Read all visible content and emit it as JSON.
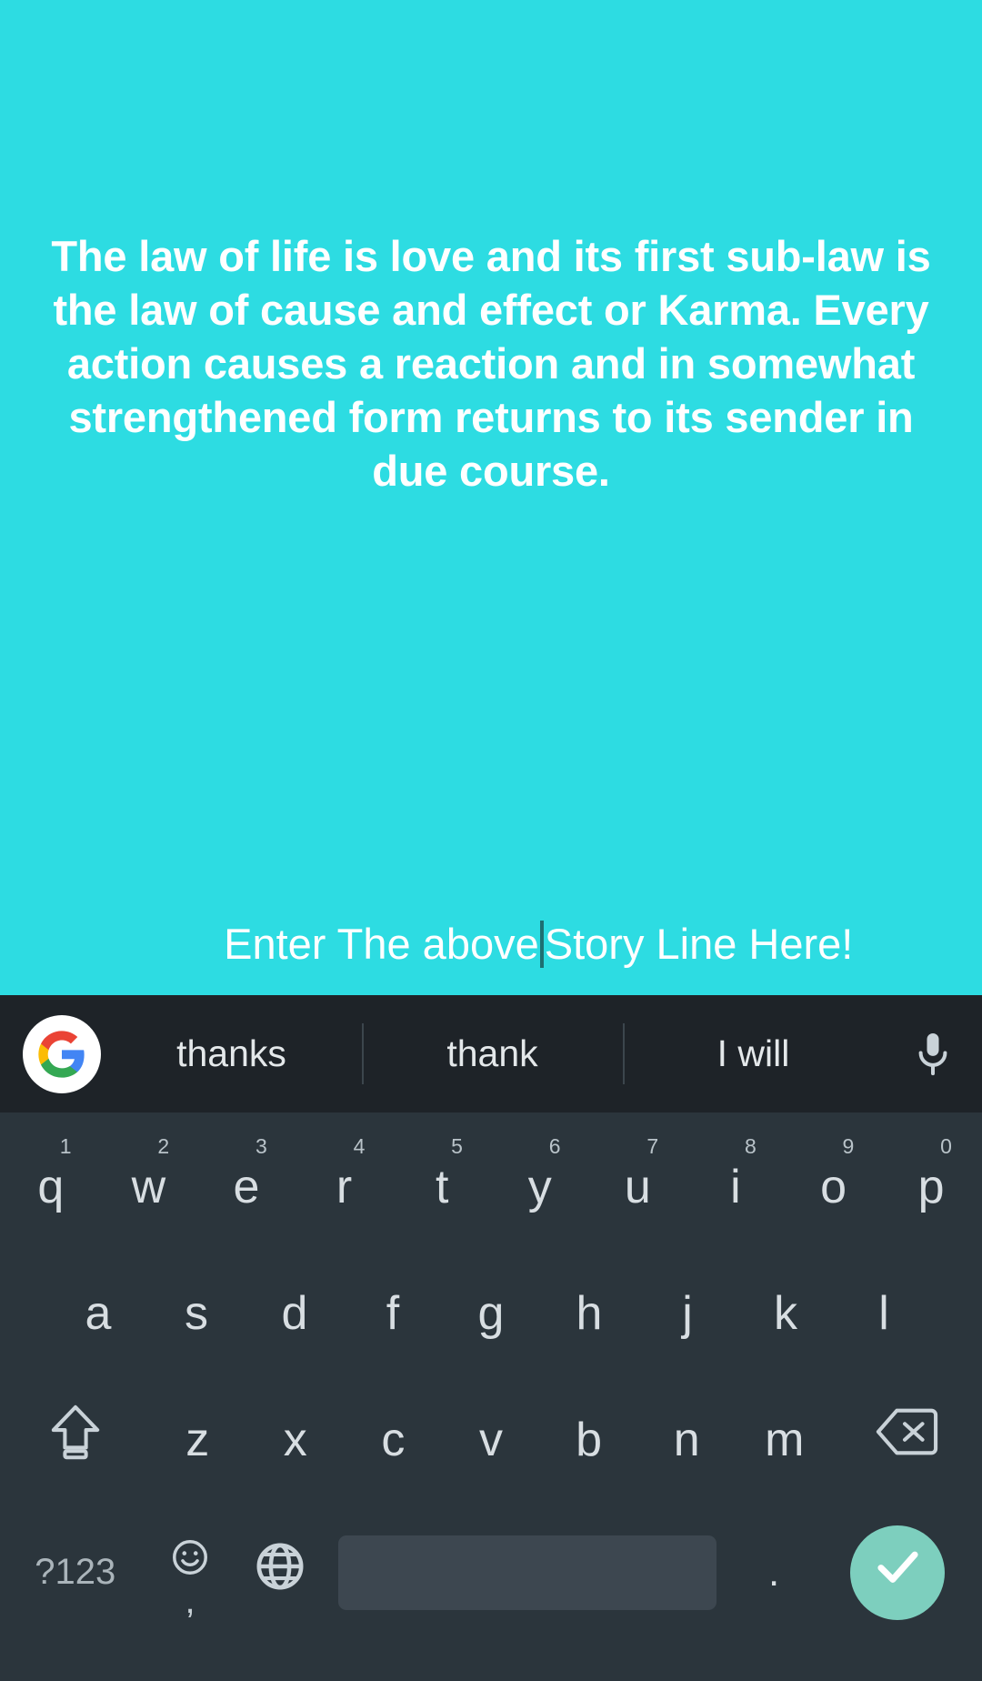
{
  "screen": {
    "background_color": "#2ddce2",
    "text_color": "#ffffff"
  },
  "content": {
    "quote": "The law of life is love and its first sub-law is the law of cause and effect or Karma. Every action causes a reaction and in somewhat strengthened form returns to its sender in due course.",
    "input_field": {
      "text_before_caret": "Enter The above",
      "text_after_caret": "Story Line Here!",
      "placeholder": "Enter The above Story Line Here!",
      "caret_color": "#1d6f72"
    }
  },
  "keyboard": {
    "background_color": "#2b353c",
    "suggestion_bar": {
      "background_color": "#1e2328",
      "logo": "google-g-logo",
      "suggestions": [
        "thanks",
        "thank",
        "I will"
      ],
      "mic": "microphone-icon"
    },
    "rows": {
      "row1": [
        {
          "key": "q",
          "hint": "1"
        },
        {
          "key": "w",
          "hint": "2"
        },
        {
          "key": "e",
          "hint": "3"
        },
        {
          "key": "r",
          "hint": "4"
        },
        {
          "key": "t",
          "hint": "5"
        },
        {
          "key": "y",
          "hint": "6"
        },
        {
          "key": "u",
          "hint": "7"
        },
        {
          "key": "i",
          "hint": "8"
        },
        {
          "key": "o",
          "hint": "9"
        },
        {
          "key": "p",
          "hint": "0"
        }
      ],
      "row2": [
        {
          "key": "a"
        },
        {
          "key": "s"
        },
        {
          "key": "d"
        },
        {
          "key": "f"
        },
        {
          "key": "g"
        },
        {
          "key": "h"
        },
        {
          "key": "j"
        },
        {
          "key": "k"
        },
        {
          "key": "l"
        }
      ],
      "row3_letters": [
        {
          "key": "z"
        },
        {
          "key": "x"
        },
        {
          "key": "c"
        },
        {
          "key": "v"
        },
        {
          "key": "b"
        },
        {
          "key": "n"
        },
        {
          "key": "m"
        }
      ],
      "shift_label": "shift-icon",
      "backspace_label": "backspace-icon",
      "row4": {
        "symbols_label": "?123",
        "emoji_label": "emoji-icon",
        "comma_label": ",",
        "globe_label": "globe-icon",
        "space_label": "",
        "period_label": ".",
        "enter_label": "checkmark-icon",
        "enter_color": "#7dcfbe"
      }
    }
  }
}
